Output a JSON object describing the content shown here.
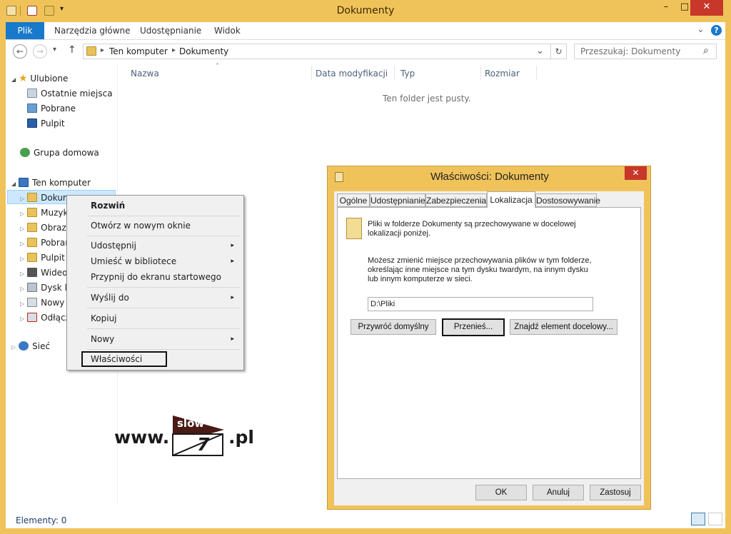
{
  "window": {
    "title": "Dokumenty",
    "minimize": "–",
    "maximize": "□",
    "close": "✕",
    "accent": "#f0c35a"
  },
  "ribbon": {
    "tabs": [
      "Plik",
      "Narzędzia główne",
      "Udostępnianie",
      "Widok"
    ],
    "expand": "⌄",
    "help": "?"
  },
  "address": {
    "back": "←",
    "forward": "→",
    "recent": "▾",
    "up": "↑",
    "breadcrumb": [
      "Ten komputer",
      "Dokumenty"
    ],
    "sep": "▸",
    "dropdown": "⌄",
    "refresh": "↻",
    "search_placeholder": "Przeszukaj: Dokumenty",
    "search_icon": "⌕"
  },
  "nav": {
    "favorites": {
      "label": "Ulubione",
      "items": [
        "Ostatnie miejsca",
        "Pobrane",
        "Pulpit"
      ]
    },
    "homegroup": "Grupa domowa",
    "computer": {
      "label": "Ten komputer",
      "items": [
        "Dokum",
        "Muzyk",
        "Obrazy",
        "Pobran",
        "Pulpit",
        "Wideo",
        "Dysk lo",
        "Nowy",
        "Odłącz"
      ]
    },
    "network": "Sieć",
    "expander": "▷",
    "expanded": "◢"
  },
  "columns": {
    "sort_arrow": "˄",
    "headers": [
      "Nazwa",
      "Data modyfikacji",
      "Typ",
      "Rozmiar"
    ]
  },
  "empty_message": "Ten folder jest pusty.",
  "status": {
    "items": "Elementy: 0"
  },
  "context_menu": {
    "items": [
      "Rozwiń",
      "Otwórz w nowym oknie",
      "Udostępnij",
      "Umieść w bibliotece",
      "Przypnij do ekranu startowego",
      "Wyślij do",
      "Kopiuj",
      "Nowy",
      "Właściwości"
    ],
    "submenu_arrow": "▸"
  },
  "dialog": {
    "title": "Właściwości: Dokumenty",
    "close": "✕",
    "tabs": [
      "Ogólne",
      "Udostępnianie",
      "Zabezpieczenia",
      "Lokalizacja",
      "Dostosowywanie"
    ],
    "active_tab": "Lokalizacja",
    "intro": "Pliki w folderze Dokumenty są przechowywane w docelowej lokalizacji poniżej.",
    "description": "Możesz zmienić miejsce przechowywania plików w tym folderze, określając inne miejsce na tym dysku twardym, na innym dysku lub innym komputerze w sieci.",
    "path": "D:\\Pliki",
    "buttons": {
      "restore": "Przywróć domyślny",
      "move": "Przenieś...",
      "find": "Znajdź element docelowy...",
      "ok": "OK",
      "cancel": "Anuluj",
      "apply": "Zastosuj"
    }
  },
  "watermark": {
    "prefix": "www.",
    "banner": "slow",
    "number": "7",
    "suffix": ".pl"
  }
}
